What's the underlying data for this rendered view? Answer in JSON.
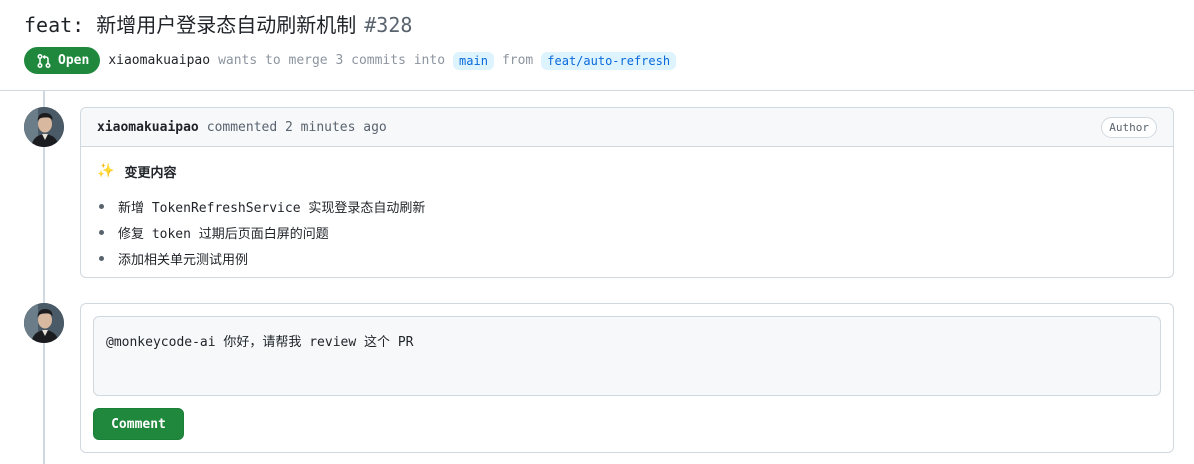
{
  "pr": {
    "title": "feat: 新增用户登录态自动刷新机制",
    "number": "#328",
    "status": "Open",
    "author": "xiaomakuaipao",
    "merge_text": "wants to merge 3 commits into",
    "base_branch": "main",
    "from_text": "from",
    "head_branch": "feat/auto-refresh"
  },
  "comment": {
    "author": "xiaomakuaipao",
    "meta": "commented 2 minutes ago",
    "badge": "Author",
    "heading_icon": "✨",
    "heading": "变更内容",
    "items": [
      "新增 TokenRefreshService 实现登录态自动刷新",
      "修复 token 过期后页面白屏的问题",
      "添加相关单元测试用例"
    ]
  },
  "reply": {
    "text": "@monkeycode-ai 你好，请帮我 review 这个 PR",
    "button_label": "Comment"
  },
  "colors": {
    "accent_green": "#1f883d",
    "link_blue": "#0969da",
    "branch_bg": "#ddf4ff",
    "border": "#d1d9e0"
  }
}
